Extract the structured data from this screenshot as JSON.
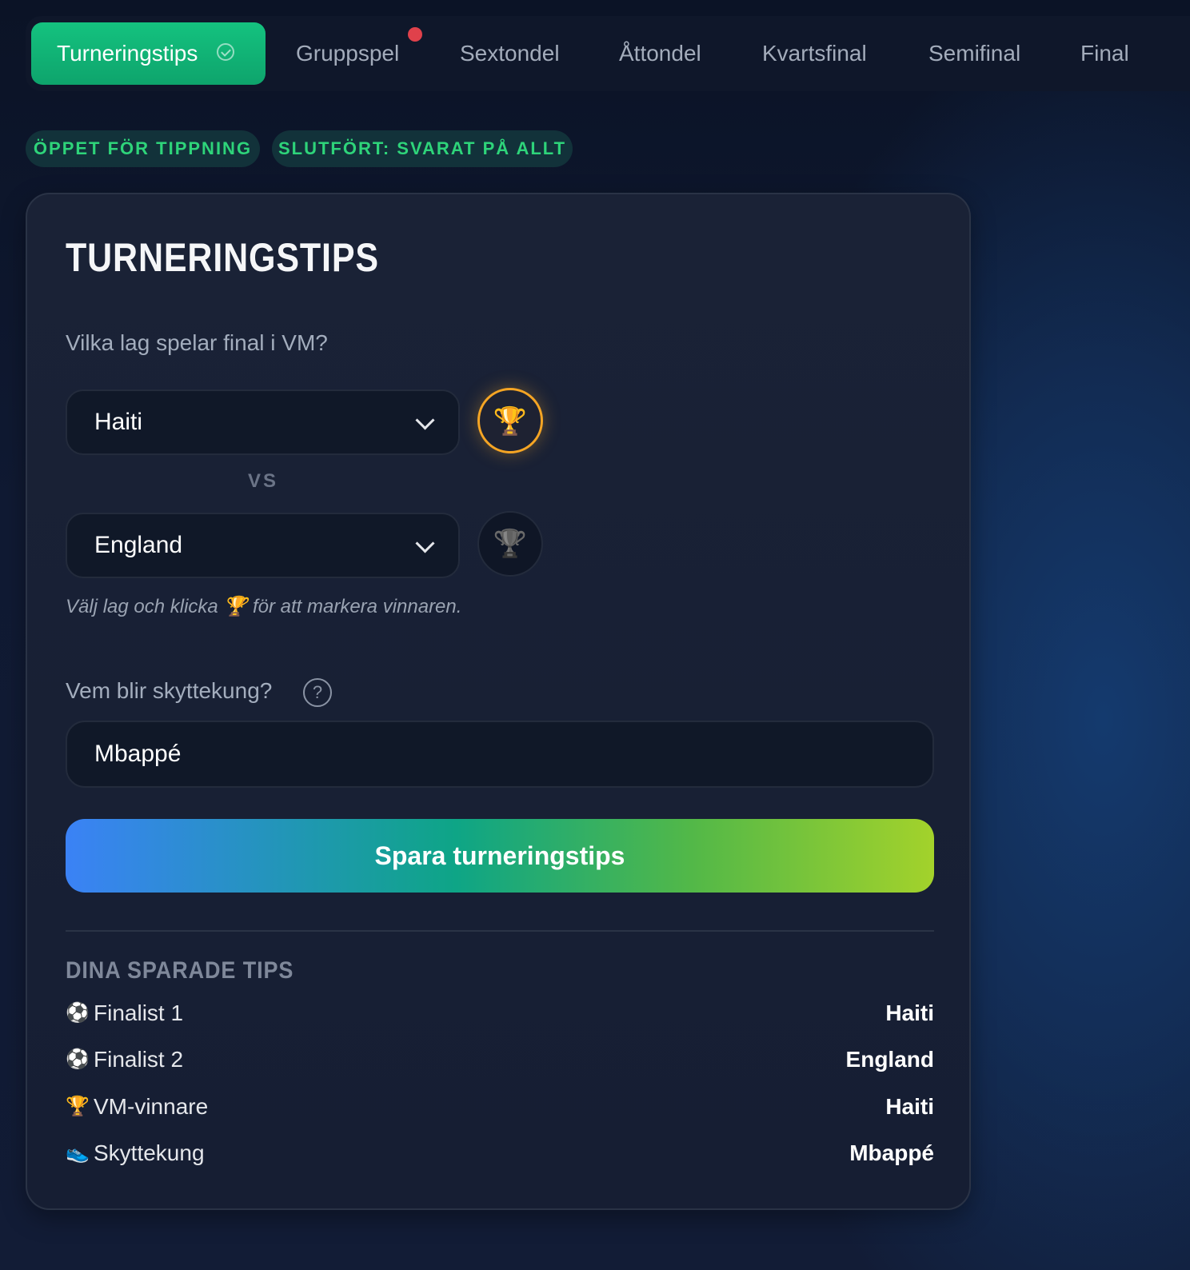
{
  "tabs": [
    {
      "label": "Turneringstips",
      "active": true
    },
    {
      "label": "Gruppspel"
    },
    {
      "label": "Sextondel"
    },
    {
      "label": "Åttondel"
    },
    {
      "label": "Kvartsfinal"
    },
    {
      "label": "Semifinal"
    },
    {
      "label": "Final"
    }
  ],
  "badges": {
    "open": "ÖPPET FÖR TIPPNING",
    "completed": "SLUTFÖRT: SVARAT PÅ ALLT"
  },
  "card": {
    "title": "TURNERINGSTIPS",
    "final_question": "Vilka lag spelar final i VM?",
    "team1": "Haiti",
    "team2": "England",
    "vs": "VS",
    "hint": "Välj lag och klicka 🏆 för att markera vinnaren.",
    "scorer_question": "Vem blir skyttekung?",
    "help_glyph": "?",
    "scorer_value": "Mbappé",
    "save_label": "Spara turneringstips",
    "saved_title": "DINA SPARADE TIPS",
    "saved": [
      {
        "icon": "⚽",
        "label": "Finalist 1",
        "value": "Haiti"
      },
      {
        "icon": "⚽",
        "label": "Finalist 2",
        "value": "England"
      },
      {
        "icon": "🏆",
        "label": "VM-vinnare",
        "value": "Haiti"
      },
      {
        "icon": "👟",
        "label": "Skyttekung",
        "value": "Mbappé"
      }
    ]
  },
  "icons": {
    "trophy": "🏆",
    "selected_winner": "team1"
  },
  "colors": {
    "accent_green": "#14c27f",
    "badge_text": "#2ed47a",
    "notification_dot": "#e0414b",
    "trophy_ring": "#f5a524"
  }
}
